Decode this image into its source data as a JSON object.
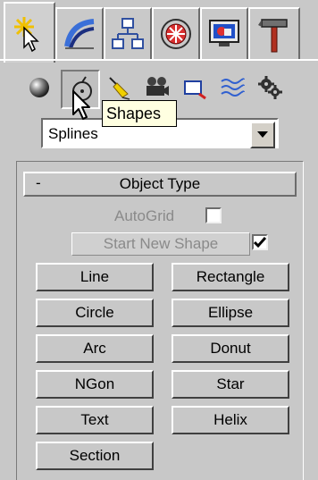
{
  "tabs": [
    {
      "icon": "create-icon",
      "active": true
    },
    {
      "icon": "modify-icon"
    },
    {
      "icon": "hierarchy-icon"
    },
    {
      "icon": "motion-icon"
    },
    {
      "icon": "display-icon"
    },
    {
      "icon": "utilities-icon"
    }
  ],
  "categories": [
    {
      "icon": "geometry-icon"
    },
    {
      "icon": "shapes-icon",
      "active": true
    },
    {
      "icon": "lights-icon"
    },
    {
      "icon": "cameras-icon"
    },
    {
      "icon": "helpers-icon"
    },
    {
      "icon": "space-warps-icon"
    },
    {
      "icon": "systems-icon"
    }
  ],
  "tooltip": "Shapes",
  "dropdown": {
    "value": "Splines"
  },
  "rollout": {
    "collapse_glyph": "-",
    "title": "Object Type",
    "autogrid_label": "AutoGrid",
    "autogrid_checked": false,
    "start_new_shape_label": "Start New Shape",
    "start_new_shape_checked": true
  },
  "buttons": {
    "line": "Line",
    "rectangle": "Rectangle",
    "circle": "Circle",
    "ellipse": "Ellipse",
    "arc": "Arc",
    "donut": "Donut",
    "ngon": "NGon",
    "star": "Star",
    "text": "Text",
    "helix": "Helix",
    "section": "Section"
  },
  "colors": {
    "panel_bg": "#c8c8c8",
    "tooltip_bg": "#ffffe1",
    "disabled_text": "#8a8a8a"
  }
}
